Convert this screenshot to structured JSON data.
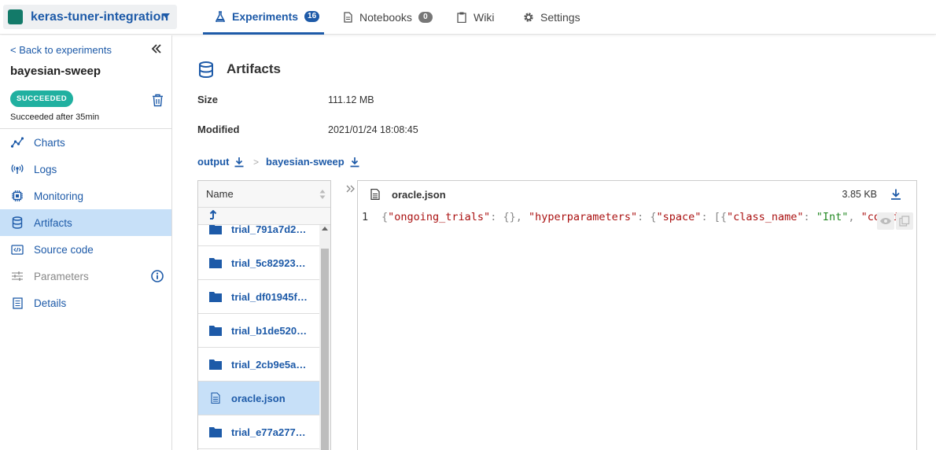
{
  "project": {
    "name": "keras-tuner-integration"
  },
  "tabs": [
    {
      "label": "Experiments",
      "count": "16",
      "active": true,
      "icon": "flask-icon"
    },
    {
      "label": "Notebooks",
      "count": "0",
      "active": false,
      "icon": "notebook-icon"
    },
    {
      "label": "Wiki",
      "active": false,
      "icon": "clipboard-icon"
    },
    {
      "label": "Settings",
      "active": false,
      "icon": "gear-icon"
    }
  ],
  "sidebar": {
    "back_label": "< Back to experiments",
    "experiment_name": "bayesian-sweep",
    "status": "SUCCEEDED",
    "status_text": "Succeeded after 35min",
    "items": [
      {
        "label": "Charts",
        "icon": "chart-icon"
      },
      {
        "label": "Logs",
        "icon": "broadcast-icon"
      },
      {
        "label": "Monitoring",
        "icon": "chip-icon"
      },
      {
        "label": "Artifacts",
        "icon": "database-icon",
        "active": true
      },
      {
        "label": "Source code",
        "icon": "code-icon"
      },
      {
        "label": "Parameters",
        "icon": "sliders-icon",
        "disabled": true
      },
      {
        "label": "Details",
        "icon": "list-icon"
      }
    ]
  },
  "main": {
    "title": "Artifacts",
    "size_label": "Size",
    "size_value": "111.12 MB",
    "modified_label": "Modified",
    "modified_value": "2021/01/24 18:08:45",
    "breadcrumb": [
      "output",
      "bayesian-sweep"
    ],
    "crumb_sep": ">"
  },
  "filelist": {
    "header": "Name",
    "rows": [
      {
        "name": "trial_791a7d2…",
        "type": "folder"
      },
      {
        "name": "trial_5c82923…",
        "type": "folder"
      },
      {
        "name": "trial_df01945f…",
        "type": "folder"
      },
      {
        "name": "trial_b1de520…",
        "type": "folder"
      },
      {
        "name": "trial_2cb9e5a…",
        "type": "folder"
      },
      {
        "name": "oracle.json",
        "type": "file",
        "selected": true
      },
      {
        "name": "trial_e77a277…",
        "type": "folder"
      }
    ]
  },
  "viewer": {
    "filename": "oracle.json",
    "size": "3.85 KB",
    "line_number": "1"
  },
  "colors": {
    "accent": "#1d5aa8",
    "success": "#20b0a0",
    "selected": "#c7e0f8"
  }
}
